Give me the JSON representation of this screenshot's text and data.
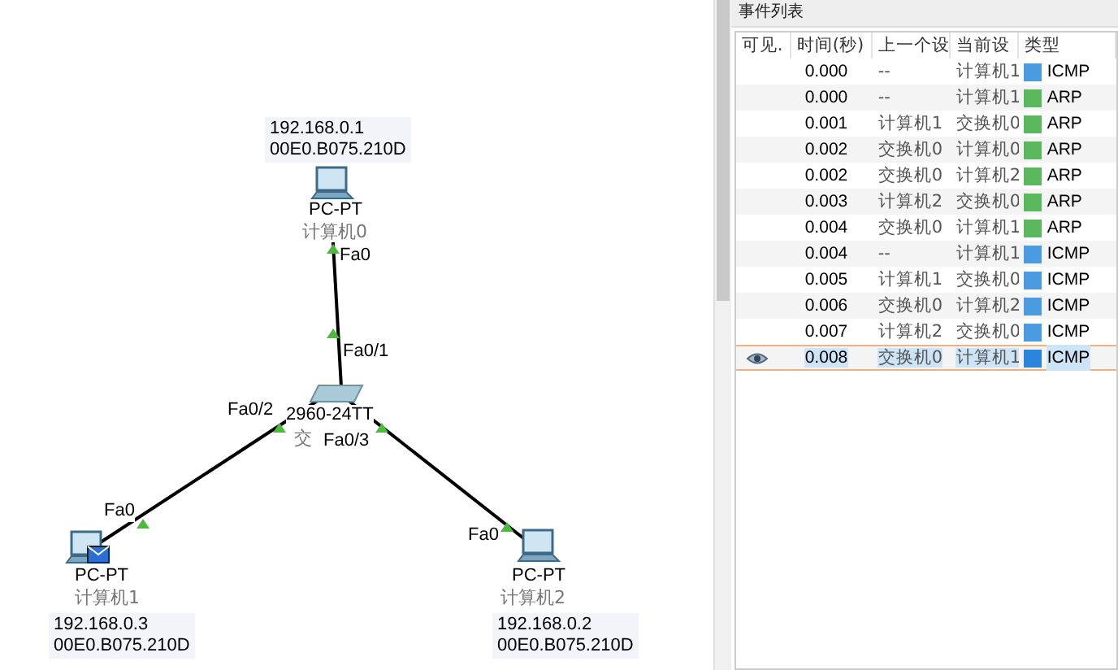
{
  "topology": {
    "devices": [
      {
        "model": "PC-PT",
        "name": "计算机0",
        "ip": "192.168.0.1",
        "mac": "00E0.B075.210D",
        "kind": "pc",
        "has_envelope": false
      },
      {
        "model": "PC-PT",
        "name": "计算机1",
        "ip": "192.168.0.3",
        "mac": "00E0.B075.210D",
        "kind": "pc",
        "has_envelope": true
      },
      {
        "model": "PC-PT",
        "name": "计算机2",
        "ip": "192.168.0.2",
        "mac": "00E0.B075.210D",
        "kind": "pc",
        "has_envelope": false
      },
      {
        "model": "2960-24TT",
        "name": "交",
        "kind": "switch"
      }
    ],
    "ports": [
      "Fa0",
      "Fa0/1",
      "Fa0/2",
      "Fa0/3",
      "Fa0",
      "Fa0"
    ]
  },
  "event_list": {
    "title": "事件列表",
    "columns": [
      "可见.",
      "时间(秒)",
      "上一个设",
      "当前设",
      "类型"
    ],
    "rows": [
      {
        "time": "0.000",
        "last": "--",
        "current": "计算机1",
        "type": "ICMP",
        "color": "#4a9be0",
        "visible": false,
        "selected": false
      },
      {
        "time": "0.000",
        "last": "--",
        "current": "计算机1",
        "type": "ARP",
        "color": "#5cb85c",
        "visible": false,
        "selected": false
      },
      {
        "time": "0.001",
        "last": "计算机1",
        "current": "交换机0",
        "type": "ARP",
        "color": "#5cb85c",
        "visible": false,
        "selected": false
      },
      {
        "time": "0.002",
        "last": "交换机0",
        "current": "计算机0",
        "type": "ARP",
        "color": "#5cb85c",
        "visible": false,
        "selected": false
      },
      {
        "time": "0.002",
        "last": "交换机0",
        "current": "计算机2",
        "type": "ARP",
        "color": "#5cb85c",
        "visible": false,
        "selected": false
      },
      {
        "time": "0.003",
        "last": "计算机2",
        "current": "交换机0",
        "type": "ARP",
        "color": "#5cb85c",
        "visible": false,
        "selected": false
      },
      {
        "time": "0.004",
        "last": "交换机0",
        "current": "计算机1",
        "type": "ARP",
        "color": "#5cb85c",
        "visible": false,
        "selected": false
      },
      {
        "time": "0.004",
        "last": "--",
        "current": "计算机1",
        "type": "ICMP",
        "color": "#4a9be0",
        "visible": false,
        "selected": false
      },
      {
        "time": "0.005",
        "last": "计算机1",
        "current": "交换机0",
        "type": "ICMP",
        "color": "#4a9be0",
        "visible": false,
        "selected": false
      },
      {
        "time": "0.006",
        "last": "交换机0",
        "current": "计算机2",
        "type": "ICMP",
        "color": "#4a9be0",
        "visible": false,
        "selected": false
      },
      {
        "time": "0.007",
        "last": "计算机2",
        "current": "交换机0",
        "type": "ICMP",
        "color": "#4a9be0",
        "visible": false,
        "selected": false
      },
      {
        "time": "0.008",
        "last": "交换机0",
        "current": "计算机1",
        "type": "ICMP",
        "color": "#2a86dc",
        "visible": true,
        "selected": true
      }
    ]
  }
}
